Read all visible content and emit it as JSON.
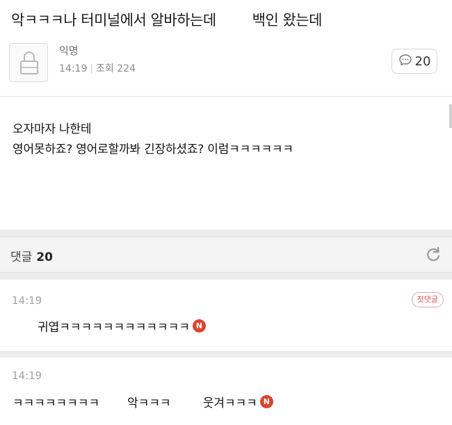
{
  "post": {
    "title_left": "악ㅋㅋㅋ나 터미널에서 알바하는데",
    "title_right": "백인 왔는데",
    "author": "익명",
    "time": "14:19",
    "views_label": "조회 224",
    "comment_count": "20",
    "body_line1": "오자마자 나한테",
    "body_line2": "영어못하죠? 영어로할까봐 긴장하셨죠? 이럼ㅋㅋㅋㅋㅋㅋ"
  },
  "comments_header": {
    "label": "댓글",
    "count": "20"
  },
  "comments": [
    {
      "time": "14:19",
      "badge": "첫댓글",
      "text": "귀엽ㅋㅋㅋㅋㅋㅋㅋㅋㅋㅋㅋㅋ",
      "new_badge": "N"
    },
    {
      "time": "14:19",
      "text_part1": "ㅋㅋㅋㅋㅋㅋㅋㅋ",
      "text_part2": "악ㅋㅋㅋ",
      "text_part3": "웃겨ㅋㅋㅋ",
      "new_badge": "N"
    }
  ],
  "colors": {
    "accent_badge": "#d9452e",
    "first_comment": "#d45c5c"
  },
  "icons": [
    "lock-avatar-icon",
    "speech-bubble-icon",
    "refresh-icon"
  ]
}
